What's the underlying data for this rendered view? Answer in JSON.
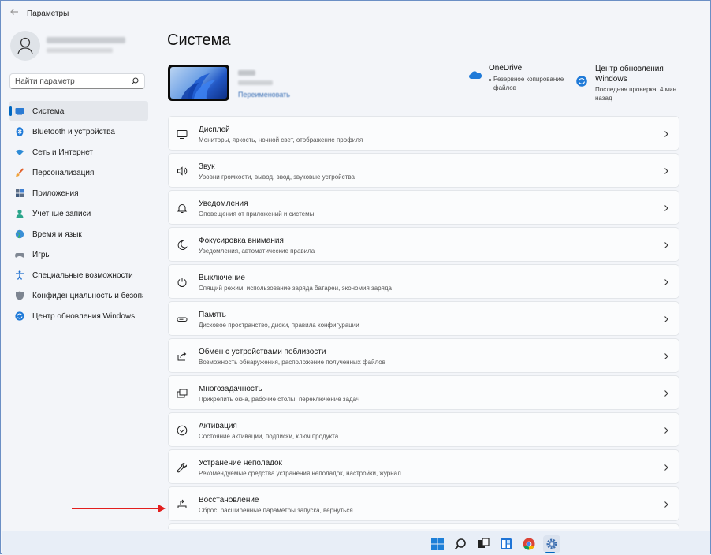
{
  "window": {
    "title": "Параметры"
  },
  "profile": {
    "name_blurred": "",
    "email_blurred": ""
  },
  "search": {
    "placeholder": "Найти параметр"
  },
  "sidebar": {
    "items": [
      {
        "label": "Система",
        "icon": "display-icon",
        "active": true
      },
      {
        "label": "Bluetooth и устройства",
        "icon": "bluetooth-icon"
      },
      {
        "label": "Сеть и Интернет",
        "icon": "wifi-icon"
      },
      {
        "label": "Персонализация",
        "icon": "brush-icon"
      },
      {
        "label": "Приложения",
        "icon": "apps-icon"
      },
      {
        "label": "Учетные записи",
        "icon": "person-icon"
      },
      {
        "label": "Время и язык",
        "icon": "globe-icon"
      },
      {
        "label": "Игры",
        "icon": "gamepad-icon"
      },
      {
        "label": "Специальные возможности",
        "icon": "accessibility-icon"
      },
      {
        "label": "Конфиденциальность и безопасность",
        "icon": "shield-icon"
      },
      {
        "label": "Центр обновления Windows",
        "icon": "update-icon"
      }
    ]
  },
  "main": {
    "title": "Система",
    "device": {
      "rename_link": "Переименовать"
    },
    "onedrive": {
      "title": "OneDrive",
      "subtitle": "Резервное копирование файлов"
    },
    "windows_update": {
      "title": "Центр обновления Windows",
      "subtitle": "Последняя проверка: 4 мин назад"
    },
    "cards": [
      {
        "title": "Дисплей",
        "subtitle": "Мониторы, яркость, ночной свет, отображение профиля",
        "icon": "monitor-icon"
      },
      {
        "title": "Звук",
        "subtitle": "Уровни громкости, вывод, ввод, звуковые устройства",
        "icon": "speaker-icon"
      },
      {
        "title": "Уведомления",
        "subtitle": "Оповещения от приложений и системы",
        "icon": "bell-icon"
      },
      {
        "title": "Фокусировка внимания",
        "subtitle": "Уведомления, автоматические правила",
        "icon": "moon-icon"
      },
      {
        "title": "Выключение",
        "subtitle": "Спящий режим, использование заряда батареи, экономия заряда",
        "icon": "power-icon"
      },
      {
        "title": "Память",
        "subtitle": "Дисковое пространство, диски, правила конфигурации",
        "icon": "storage-icon"
      },
      {
        "title": "Обмен с устройствами поблизости",
        "subtitle": "Возможность обнаружения, расположение полученных файлов",
        "icon": "share-icon"
      },
      {
        "title": "Многозадачность",
        "subtitle": "Прикрепить окна, рабочие столы, переключение задач",
        "icon": "multitask-icon"
      },
      {
        "title": "Активация",
        "subtitle": "Состояние активации, подписки, ключ продукта",
        "icon": "check-circle-icon"
      },
      {
        "title": "Устранение неполадок",
        "subtitle": "Рекомендуемые средства устранения неполадок, настройки, журнал",
        "icon": "wrench-icon"
      },
      {
        "title": "Восстановление",
        "subtitle": "Сброс, расширенные параметры запуска, вернуться",
        "icon": "recovery-icon"
      },
      {
        "title": "",
        "subtitle": "",
        "icon": ""
      }
    ]
  },
  "taskbar": {
    "items": [
      {
        "name": "start-button",
        "icon": "windows-logo-icon"
      },
      {
        "name": "search-button",
        "icon": "search-icon"
      },
      {
        "name": "task-view-button",
        "icon": "task-view-icon"
      },
      {
        "name": "widgets-button",
        "icon": "widgets-icon"
      },
      {
        "name": "chrome-button",
        "icon": "chrome-icon"
      },
      {
        "name": "settings-button",
        "icon": "gear-icon",
        "active": true
      }
    ]
  },
  "colors": {
    "accent": "#0067c0",
    "annotation_arrow": "#e21e1e"
  }
}
